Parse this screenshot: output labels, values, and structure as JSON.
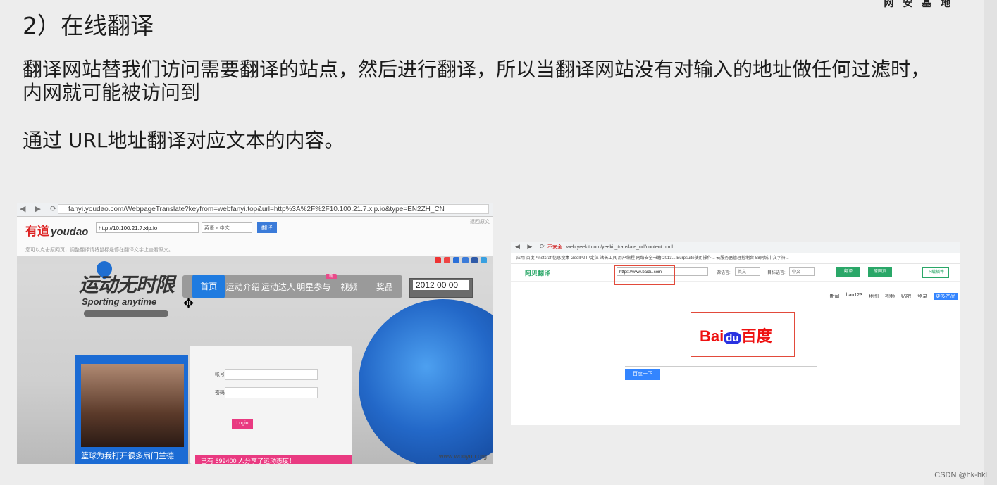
{
  "slide": {
    "logo_text": "网 安 基 地",
    "heading": "2）在线翻译",
    "para1": "翻译网站替我们访问需要翻译的站点，然后进行翻译，所以当翻译网站没有对输入的地址做任何过滤时，内网就可能被访问到",
    "para2": "通过 URL地址翻译对应文本的内容。",
    "credit": "CSDN @hk-hkl"
  },
  "youdao_shot": {
    "browser_url": "fanyi.youdao.com/WebpageTranslate?keyfrom=webfanyi.top&url=http%3A%2F%2F10.100.21.7.xip.io&type=EN2ZH_CN",
    "logo_cn": "有道",
    "logo_en": "youdao",
    "input_value": "http://10.100.21.7.xip.io",
    "lang_select": "英语 » 中文",
    "translate_button": "翻译",
    "top_right_link": "返回原文",
    "tip_text": "您可以点击原网页，调整翻译请将鼠标悬停在翻译文字上查看原文。",
    "share_label": "",
    "site_logo": "运动无时限",
    "site_subtitle": "Sporting anytime",
    "nav_items": [
      "首页",
      "运动介绍",
      "运动达人",
      "明星参与",
      "视频",
      "奖品"
    ],
    "nav_badge": "新",
    "date_text": "2012 00 00",
    "login_account_label": "帐号:",
    "login_password_label": "密码:",
    "login_button": "Login",
    "login_promo": "已有 699400 人分享了运动态度！",
    "photo_caption": "篮球为我打开很多扇门兰德",
    "footer_domain": "www.wooyun.org"
  },
  "yeekit_shot": {
    "browser_url": "web.yeekit.com/yeekit_translate_url/content.html",
    "insecure_label": "不安全",
    "bookmarks": "应用   百度P   netcraft信息搜集   GeoIP2 IP定位   站长工具   用户编程   网络安全书籍 2013...   Burpsuite使用操作...   云服务器管理控制台   58同城中文字符...",
    "logo": "阿贝翻译",
    "url_input": "https://www.baidu.com",
    "source_label": "源语言:",
    "source_value": "英文",
    "target_label": "目标语言:",
    "target_value": "中文",
    "translate_btn": "翻译",
    "original_btn": "原网页",
    "download_btn": "下载插件",
    "baidu_links": [
      "新闻",
      "hao123",
      "地图",
      "视频",
      "贴吧",
      "登录"
    ],
    "baidu_more": "更多产品",
    "baidu_logo_left": "Bai",
    "baidu_logo_mid": "du",
    "baidu_logo_right": "百度",
    "baidu_button": "百度一下"
  },
  "colors": {
    "accent_blue": "#1f7be0",
    "accent_pink": "#e93a81",
    "highlight_red": "#e24a3b",
    "baidu_blue": "#3385ff"
  }
}
